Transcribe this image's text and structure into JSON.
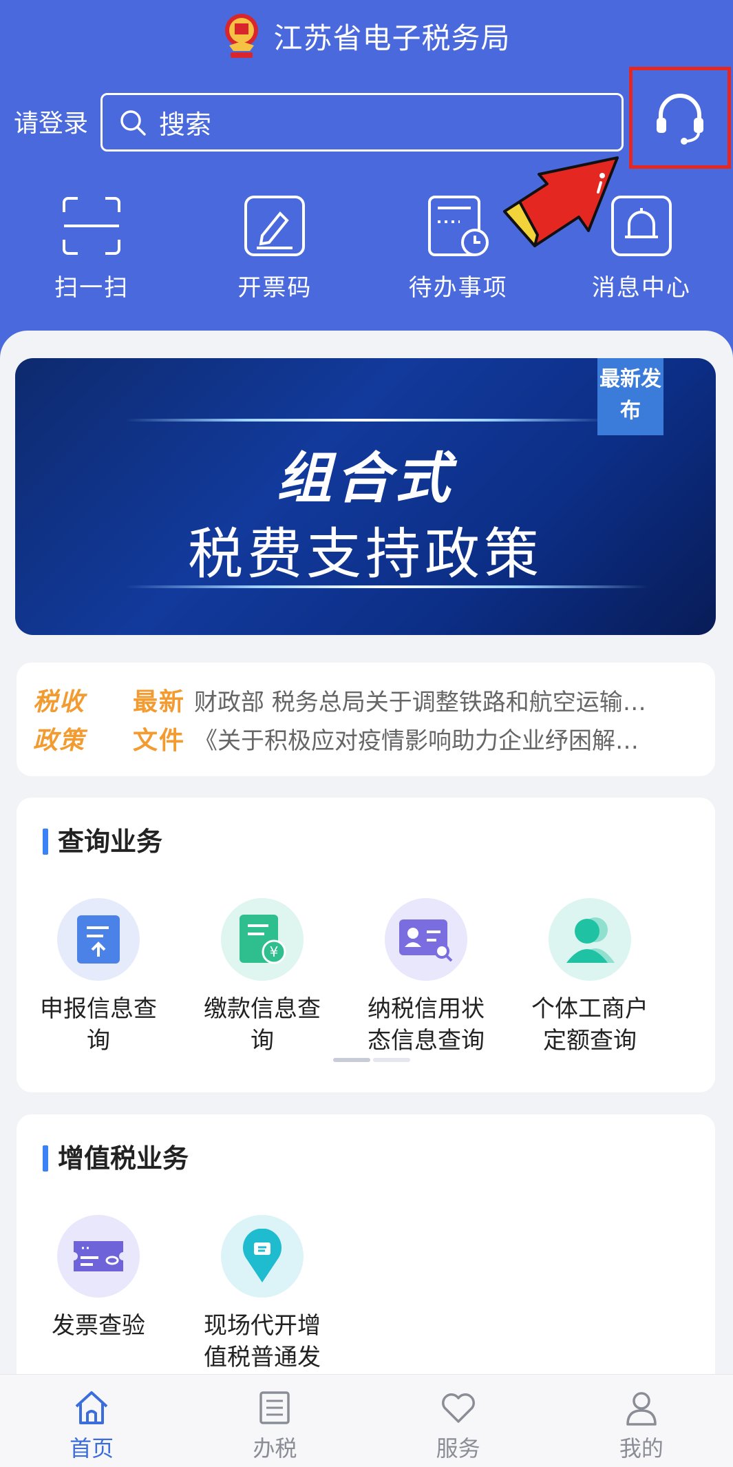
{
  "header": {
    "title": "江苏省电子税务局",
    "login_label": "请登录",
    "search_placeholder": "搜索"
  },
  "quick_actions": [
    {
      "label": "扫一扫",
      "icon": "scan-icon"
    },
    {
      "label": "开票码",
      "icon": "invoice-code-icon"
    },
    {
      "label": "待办事项",
      "icon": "todo-icon"
    },
    {
      "label": "消息中心",
      "icon": "bell-icon"
    }
  ],
  "banner": {
    "tag": "最新发布",
    "line1": "组合式",
    "line2": "税费支持政策"
  },
  "news": {
    "badge_a": "税收政策",
    "badge_b": "最新文件",
    "items": [
      "财政部 税务总局关于调整铁路和航空运输…",
      "《关于积极应对疫情影响助力企业纾困解…"
    ]
  },
  "query_section": {
    "title": "查询业务",
    "items": [
      {
        "label": "申报信息查询",
        "icon": "declaration-icon"
      },
      {
        "label": "缴款信息查询",
        "icon": "payment-icon"
      },
      {
        "label": "纳税信用状态信息查询",
        "icon": "credit-card-icon"
      },
      {
        "label": "个体工商户定额查询",
        "icon": "person-icon"
      }
    ]
  },
  "vat_section": {
    "title": "增值税业务",
    "items": [
      {
        "label": "发票查验",
        "icon": "invoice-check-icon"
      },
      {
        "label": "现场代开增值税普通发",
        "icon": "location-invoice-icon"
      }
    ]
  },
  "tabbar": {
    "items": [
      {
        "label": "首页",
        "icon": "home-icon",
        "active": true
      },
      {
        "label": "办税",
        "icon": "list-icon"
      },
      {
        "label": "服务",
        "icon": "heart-icon"
      },
      {
        "label": "我的",
        "icon": "user-icon"
      }
    ]
  },
  "colors": {
    "header_bg": "#4a69dd",
    "accent": "#3b6ddc",
    "highlight_box": "#e52722",
    "news_orange": "#f29b30"
  }
}
